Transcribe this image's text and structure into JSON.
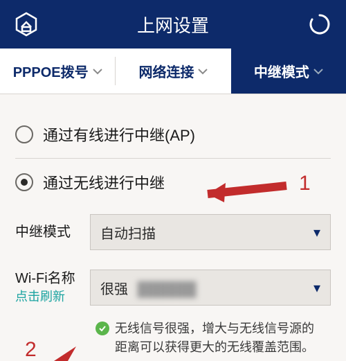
{
  "header": {
    "title": "上网设置"
  },
  "tabs": [
    {
      "label": "PPPOE拨号",
      "active": false
    },
    {
      "label": "网络连接",
      "active": false
    },
    {
      "label": "中继模式",
      "active": true
    }
  ],
  "radios": {
    "wired": {
      "label": "通过有线进行中继(AP)",
      "checked": false
    },
    "wireless": {
      "label": "通过无线进行中继",
      "checked": true
    }
  },
  "form": {
    "mode": {
      "label": "中继模式",
      "value": "自动扫描"
    },
    "wifi": {
      "label": "Wi-Fi名称",
      "sublabel": "点击刷新",
      "value": "很强",
      "blurred": "██████"
    }
  },
  "hint": {
    "text": "无线信号很强，增大与无线信号源的距离可以获得更大的无线覆盖范围。"
  },
  "annotations": {
    "one": "1",
    "two": "2"
  },
  "colors": {
    "brand": "#0d2a6a",
    "accent": "#1aa3a0",
    "ok": "#5bb54b",
    "anno": "#c22c2c"
  }
}
